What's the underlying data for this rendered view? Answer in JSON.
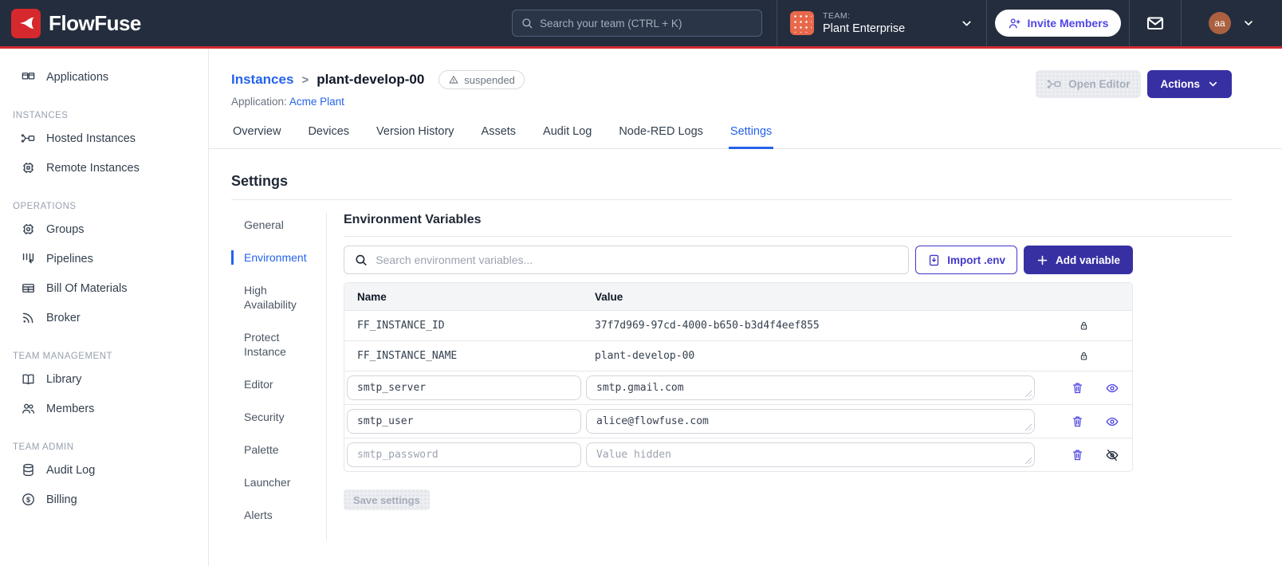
{
  "colors": {
    "header_bg": "#232d3d",
    "brand_red": "#d6292d",
    "accent_indigo": "#3730a3",
    "icon_indigo": "#4f46e5",
    "link_blue": "#2563eb"
  },
  "header": {
    "brand": "FlowFuse",
    "search_placeholder": "Search your team (CTRL + K)",
    "team_label": "TEAM:",
    "team_name": "Plant Enterprise",
    "invite_button": "Invite Members",
    "avatar_initials": "aa"
  },
  "sidebar": {
    "applications_label": "Applications",
    "sections": [
      {
        "label": "INSTANCES",
        "items": [
          {
            "label": "Hosted Instances"
          },
          {
            "label": "Remote Instances"
          }
        ]
      },
      {
        "label": "OPERATIONS",
        "items": [
          {
            "label": "Groups"
          },
          {
            "label": "Pipelines"
          },
          {
            "label": "Bill Of Materials"
          },
          {
            "label": "Broker"
          }
        ]
      },
      {
        "label": "TEAM MANAGEMENT",
        "items": [
          {
            "label": "Library"
          },
          {
            "label": "Members"
          }
        ]
      },
      {
        "label": "TEAM ADMIN",
        "items": [
          {
            "label": "Audit Log"
          },
          {
            "label": "Billing"
          }
        ]
      }
    ]
  },
  "page": {
    "breadcrumb_root": "Instances",
    "breadcrumb_separator": ">",
    "instance_name": "plant-develop-00",
    "status_badge": "suspended",
    "application_label": "Application:",
    "application_name": "Acme Plant",
    "open_editor_button": "Open Editor",
    "actions_button": "Actions"
  },
  "tabs": {
    "active": "Settings",
    "items": [
      {
        "label": "Overview"
      },
      {
        "label": "Devices"
      },
      {
        "label": "Version History"
      },
      {
        "label": "Assets"
      },
      {
        "label": "Audit Log"
      },
      {
        "label": "Node-RED Logs"
      },
      {
        "label": "Settings"
      }
    ]
  },
  "settings": {
    "title": "Settings",
    "nav": {
      "active": "Environment",
      "items": [
        {
          "label": "General"
        },
        {
          "label": "Environment"
        },
        {
          "label": "High Availability"
        },
        {
          "label": "Protect Instance"
        },
        {
          "label": "Editor"
        },
        {
          "label": "Security"
        },
        {
          "label": "Palette"
        },
        {
          "label": "Launcher"
        },
        {
          "label": "Alerts"
        }
      ]
    },
    "env": {
      "section_title": "Environment Variables",
      "search_placeholder": "Search environment variables...",
      "import_button": "Import .env",
      "add_button": "Add variable",
      "save_button": "Save settings",
      "table": {
        "columns": [
          "Name",
          "Value"
        ],
        "locked_rows": [
          {
            "name": "FF_INSTANCE_ID",
            "value": "37f7d969-97cd-4000-b650-b3d4f4eef855"
          },
          {
            "name": "FF_INSTANCE_NAME",
            "value": "plant-develop-00"
          }
        ],
        "editable_rows": [
          {
            "name": "smtp_server",
            "value": "smtp.gmail.com"
          },
          {
            "name": "smtp_user",
            "value": "alice@flowfuse.com"
          },
          {
            "name": "smtp_password",
            "value": "",
            "value_placeholder": "Value hidden"
          }
        ]
      }
    }
  }
}
